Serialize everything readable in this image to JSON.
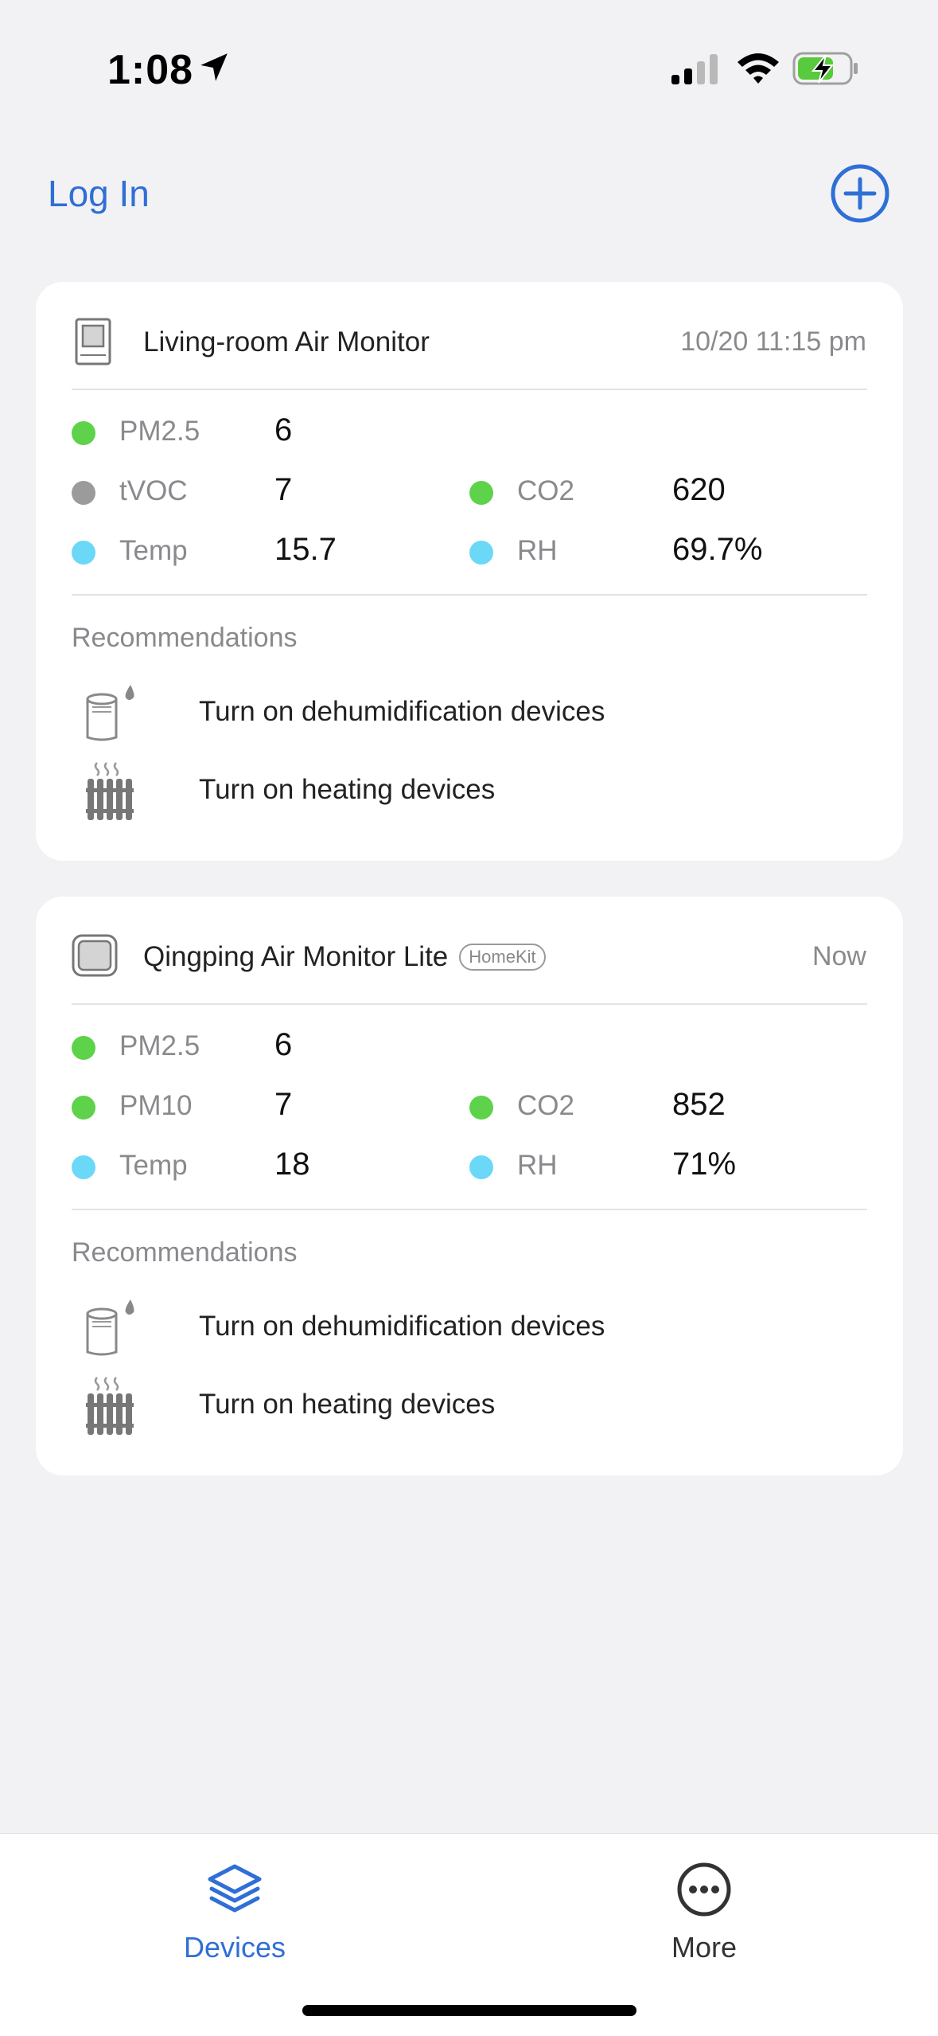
{
  "status_bar": {
    "time": "1:08"
  },
  "header": {
    "login_label": "Log In"
  },
  "devices": [
    {
      "name": "Living-room Air Monitor",
      "badge": "",
      "time": "10/20 11:15 pm",
      "metrics": [
        {
          "label": "PM2.5",
          "value": "6",
          "color": "#5ed24a"
        },
        {
          "label": "tVOC",
          "value": "7",
          "color": "#9b9b9b"
        },
        {
          "label": "CO2",
          "value": "620",
          "color": "#5ed24a"
        },
        {
          "label": "Temp",
          "value": "15.7",
          "color": "#6ad8f6"
        },
        {
          "label": "RH",
          "value": "69.7%",
          "color": "#6ad8f6"
        }
      ],
      "recommendations_title": "Recommendations",
      "recommendations": [
        {
          "icon": "dehumidifier-icon",
          "text": "Turn on dehumidification devices"
        },
        {
          "icon": "heater-icon",
          "text": "Turn on heating devices"
        }
      ]
    },
    {
      "name": "Qingping Air Monitor Lite",
      "badge": "HomeKit",
      "time": "Now",
      "metrics": [
        {
          "label": "PM2.5",
          "value": "6",
          "color": "#5ed24a"
        },
        {
          "label": "PM10",
          "value": "7",
          "color": "#5ed24a"
        },
        {
          "label": "CO2",
          "value": "852",
          "color": "#5ed24a"
        },
        {
          "label": "Temp",
          "value": "18",
          "color": "#6ad8f6"
        },
        {
          "label": "RH",
          "value": "71%",
          "color": "#6ad8f6"
        }
      ],
      "recommendations_title": "Recommendations",
      "recommendations": [
        {
          "icon": "dehumidifier-icon",
          "text": "Turn on dehumidification devices"
        },
        {
          "icon": "heater-icon",
          "text": "Turn on heating devices"
        }
      ]
    }
  ],
  "tab_bar": {
    "devices_label": "Devices",
    "more_label": "More",
    "active_color": "#2f6fd6",
    "inactive_color": "#333333"
  }
}
